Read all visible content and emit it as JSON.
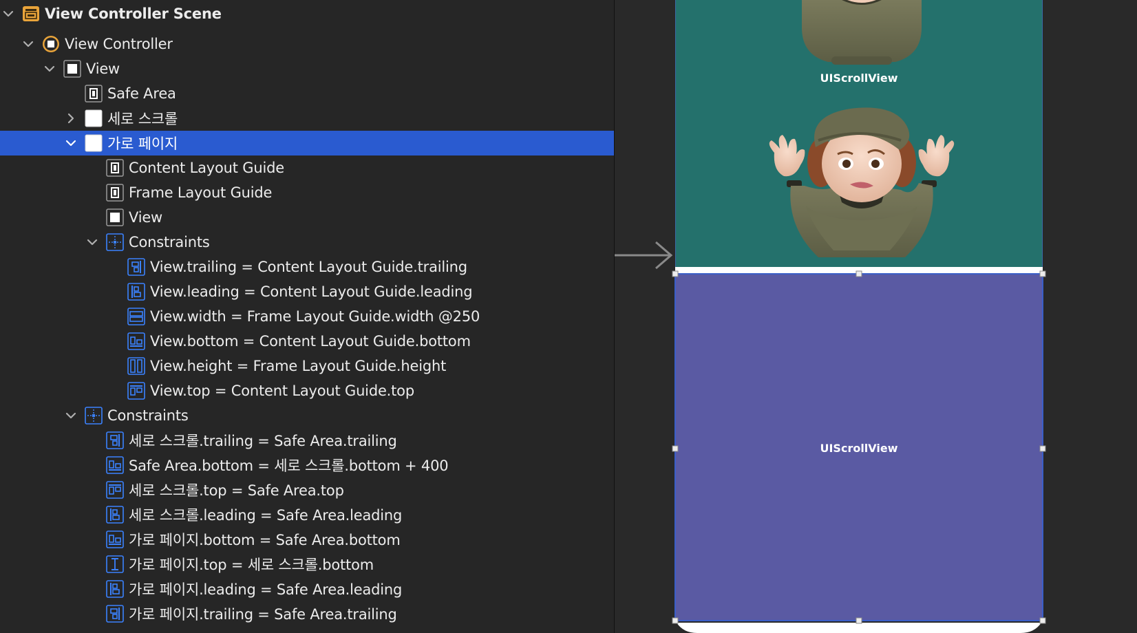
{
  "outline": {
    "rows": [
      {
        "label": "View Controller Scene",
        "icon": "scene-icon",
        "disclosure": "open"
      },
      {
        "label": "View Controller",
        "icon": "view-controller-icon",
        "disclosure": "open"
      },
      {
        "label": "View",
        "icon": "view-icon",
        "disclosure": "open"
      },
      {
        "label": "Safe Area",
        "icon": "layout-guide-icon",
        "disclosure": "none"
      },
      {
        "label": "세로 스크롤",
        "icon": "scroll-view-icon",
        "disclosure": "closed"
      },
      {
        "label": "가로 페이지",
        "icon": "scroll-view-icon",
        "disclosure": "open",
        "selected": true
      },
      {
        "label": "Content Layout Guide",
        "icon": "layout-guide-icon",
        "disclosure": "none"
      },
      {
        "label": "Frame Layout Guide",
        "icon": "layout-guide-icon",
        "disclosure": "none"
      },
      {
        "label": "View",
        "icon": "view-icon",
        "disclosure": "none"
      },
      {
        "label": "Constraints",
        "icon": "constraints-group-icon",
        "disclosure": "open"
      },
      {
        "label": "View.trailing = Content Layout Guide.trailing",
        "icon": "trailing-constraint-icon",
        "disclosure": "none"
      },
      {
        "label": "View.leading = Content Layout Guide.leading",
        "icon": "leading-constraint-icon",
        "disclosure": "none"
      },
      {
        "label": "View.width = Frame Layout Guide.width @250",
        "icon": "width-constraint-icon",
        "disclosure": "none"
      },
      {
        "label": "View.bottom = Content Layout Guide.bottom",
        "icon": "bottom-constraint-icon",
        "disclosure": "none"
      },
      {
        "label": "View.height = Frame Layout Guide.height",
        "icon": "height-constraint-icon",
        "disclosure": "none"
      },
      {
        "label": "View.top = Content Layout Guide.top",
        "icon": "top-constraint-icon",
        "disclosure": "none"
      },
      {
        "label": "Constraints",
        "icon": "constraints-group-icon",
        "disclosure": "open"
      },
      {
        "label": "세로 스크롤.trailing = Safe Area.trailing",
        "icon": "trailing-constraint-icon",
        "disclosure": "none"
      },
      {
        "label": "Safe Area.bottom = 세로 스크롤.bottom + 400",
        "icon": "bottom-constraint-icon",
        "disclosure": "none"
      },
      {
        "label": "세로 스크롤.top = Safe Area.top",
        "icon": "top-constraint-icon",
        "disclosure": "none"
      },
      {
        "label": "세로 스크롤.leading = Safe Area.leading",
        "icon": "leading-constraint-icon",
        "disclosure": "none"
      },
      {
        "label": "가로 페이지.bottom = Safe Area.bottom",
        "icon": "bottom-constraint-icon",
        "disclosure": "none"
      },
      {
        "label": "가로 페이지.top = 세로 스크롤.bottom",
        "icon": "vertical-spacing-constraint-icon",
        "disclosure": "none"
      },
      {
        "label": "가로 페이지.leading = Safe Area.leading",
        "icon": "leading-constraint-icon",
        "disclosure": "none"
      },
      {
        "label": "가로 페이지.trailing = Safe Area.trailing",
        "icon": "trailing-constraint-icon",
        "disclosure": "none"
      }
    ]
  },
  "canvas": {
    "top_scroll_label": "UIScrollView",
    "bottom_scroll_label": "UIScrollView",
    "colors": {
      "teal": "#24716c",
      "purple": "#5a5aa3",
      "selection": "#2a5bd0",
      "constraint_icon": "#3b82ff",
      "scene_icon": "#e9a43a"
    }
  }
}
